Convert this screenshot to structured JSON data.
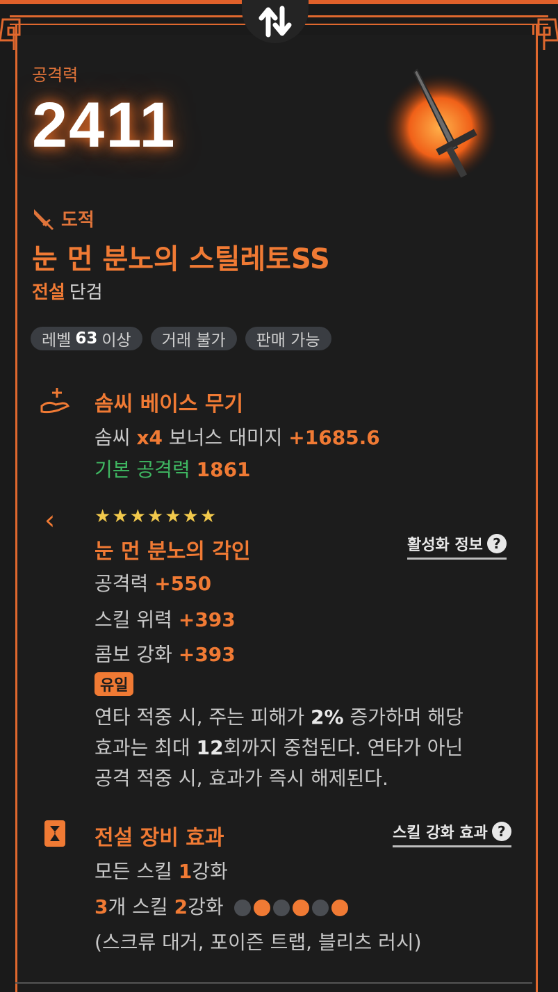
{
  "attack": {
    "label": "공격력",
    "value": "2411"
  },
  "item": {
    "class_label": "도적",
    "name": "눈 먼 분노의 스틸레토SS",
    "rarity": "전설",
    "type": "단검"
  },
  "tags": [
    {
      "prefix": "레벨",
      "bold": "63",
      "suffix": "이상"
    },
    {
      "text": "거래 불가"
    },
    {
      "text": "판매 가능"
    }
  ],
  "soulseed": {
    "title": "솜씨 베이스 무기",
    "line1_a": "솜씨",
    "line1_b": "x4",
    "line1_c": "보너스 대미지",
    "line1_d": "+1685.6",
    "line2_a": "기본 공격력",
    "line2_b": "1861"
  },
  "engraving": {
    "stars": "★★★★★★★",
    "title": "눈 먼 분노의 각인",
    "info_link": "활성화 정보",
    "stats": [
      {
        "label": "공격력",
        "value": "+550"
      },
      {
        "label": "스킬 위력",
        "value": "+393"
      },
      {
        "label": "콤보 강화",
        "value": "+393"
      }
    ],
    "badge": "유일",
    "desc_1": "연타 적중 시, 주는 피해가 ",
    "desc_1b": "2%",
    "desc_1c": " 증가하며 해당",
    "desc_2a": "효과는 최대 ",
    "desc_2b": "12",
    "desc_2c": "회까지 중첩된다. 연타가 아닌",
    "desc_3": "공격 적중 시, 효과가 즉시 해제된다."
  },
  "legend_effect": {
    "title": "전설 장비 효과",
    "info_link": "스킬 강화 효과",
    "line1_a": "모든 스킬 ",
    "line1_b": "1",
    "line1_c": "강화",
    "line2_a": "3",
    "line2_b": "개 스킬 ",
    "line2_c": "2",
    "line2_d": "강화",
    "dot_states": [
      "off",
      "on",
      "off",
      "on",
      "off",
      "on"
    ],
    "skills": "(스크류 대거, 포이즌 트랩, 블리츠 러시)"
  },
  "colors": {
    "accent": "#f07a34",
    "green": "#3fb862",
    "star": "#f2c94c",
    "dot_off": "#4a4d52"
  }
}
